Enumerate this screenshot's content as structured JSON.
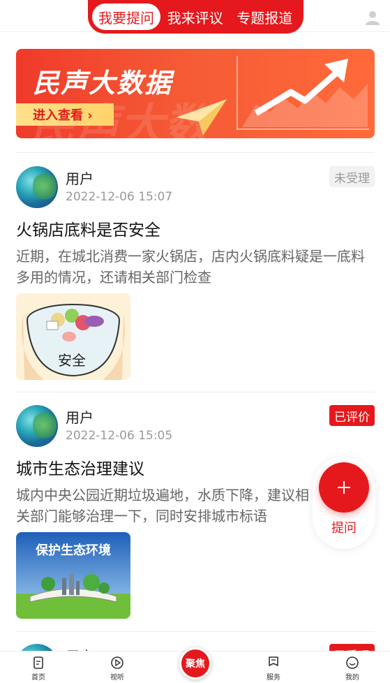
{
  "tabs": [
    {
      "label": "我要提问",
      "active": true
    },
    {
      "label": "我来评议",
      "active": false
    },
    {
      "label": "专题报道",
      "active": false
    }
  ],
  "banner": {
    "title": "民声大数据",
    "button": "进入查看 ›",
    "ghost_text": "民声大数"
  },
  "posts": [
    {
      "user": "用户",
      "time": "2022-12-06 15:07",
      "status": "未受理",
      "title": "火锅店底料是否安全",
      "body": "近期，在城北消费一家火锅店，店内火锅底料疑是一底料多用的情况，还请相关部门检查",
      "image_text": "安全"
    },
    {
      "user": "用户",
      "time": "2022-12-06 15:05",
      "status": "已评价",
      "title": "城市生态治理建议",
      "body": "城内中央公园近期垃圾遍地，水质下降，建议相关部门能够治理一下，同时安排城市标语",
      "image_text": "保护生态环境"
    },
    {
      "user": "用户",
      "status": "已受理"
    }
  ],
  "fab": {
    "label": "提问"
  },
  "bottom_nav": [
    {
      "label": "首页"
    },
    {
      "label": "视听"
    },
    {
      "label": "聚焦"
    },
    {
      "label": "服务"
    },
    {
      "label": "我的"
    }
  ],
  "colors": {
    "brand": "#e5191d",
    "status_gray": "#999999"
  }
}
